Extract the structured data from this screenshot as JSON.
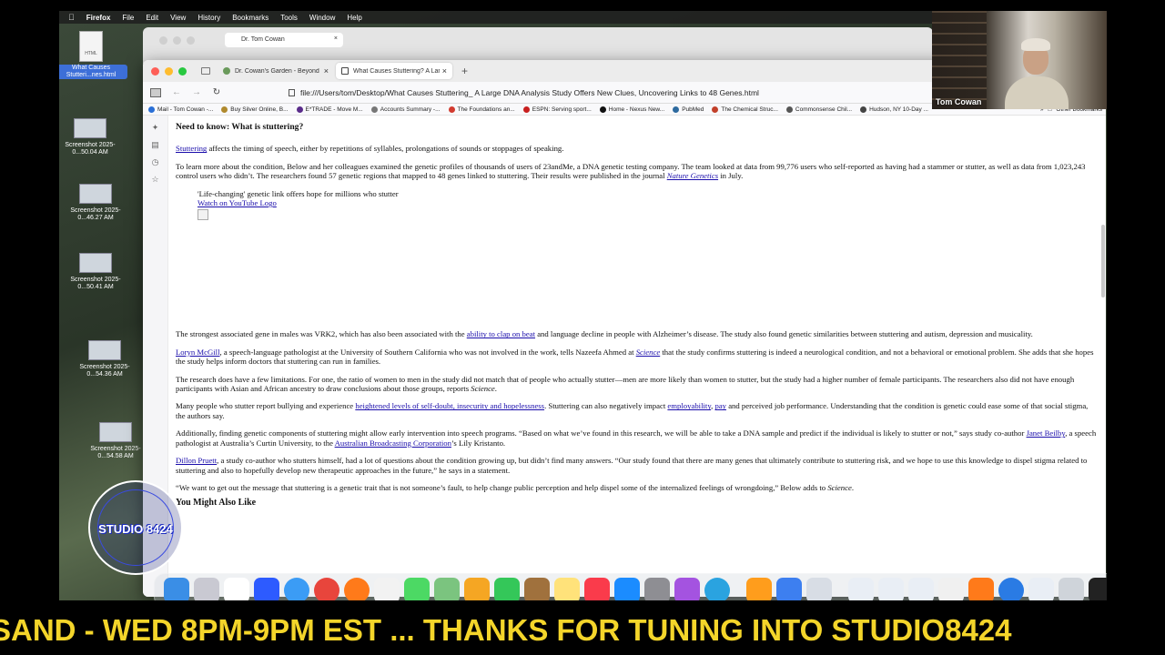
{
  "menubar": {
    "app_name": "Firefox",
    "items": [
      "File",
      "Edit",
      "View",
      "History",
      "Bookmarks",
      "Tools",
      "Window",
      "Help"
    ]
  },
  "desktop": {
    "icons": [
      {
        "label": "What Causes Stutteri...nes.html",
        "type": "file",
        "file_badge": "HTML",
        "selected": true
      },
      {
        "label": "Screenshot 2025-0...50.04 AM",
        "type": "screenshot"
      },
      {
        "label": "Screenshot 2025-0...46.27 AM",
        "type": "screenshot"
      },
      {
        "label": "Screenshot 2025-0...50.41 AM",
        "type": "screenshot"
      },
      {
        "label": "Screenshot 2025-0...54.36 AM",
        "type": "screenshot"
      },
      {
        "label": "Screenshot 2025-0...54.58 AM",
        "type": "screenshot"
      }
    ]
  },
  "background_window": {
    "tab_title": "Dr. Tom Cowan"
  },
  "browser": {
    "tabs": [
      {
        "title": "Dr. Cowan's Garden - Beyond C",
        "active": false
      },
      {
        "title": "What Causes Stuttering? A Larg",
        "active": true
      }
    ],
    "url": "file:///Users/tom/Desktop/What Causes Stuttering_ A Large DNA Analysis Study Offers New Clues, Uncovering Links to 48 Genes.html",
    "bookmarks": [
      "Mail - Tom Cowan -...",
      "Buy Silver Online, B...",
      "E*TRADE - Move M...",
      "Accounts Summary -...",
      "The Foundations an...",
      "ESPN: Serving sport...",
      "Home - Nexus New...",
      "PubMed",
      "The Chemical Struc...",
      "Commonsense Chil...",
      "Hudson, NY 10-Day ..."
    ],
    "other_bookmarks": "Other Bookmarks"
  },
  "article": {
    "heading": "Need to know: What is stuttering?",
    "p1": {
      "link": "Stuttering",
      "rest": " affects the timing of speech, either by repetitions of syllables, prolongations of sounds or stoppages of speaking."
    },
    "p2": {
      "text": "To learn more about the condition, Below and her colleagues examined the genetic profiles of thousands of users of 23andMe, a DNA genetic testing company. The team looked at data from 99,776 users who self-reported as having had a stammer or stutter, as well as data from 1,023,243 control users who didn’t. The researchers found 57 genetic regions that mapped to 48 genes linked to stuttering. Their results were published in the journal ",
      "link": "Nature Genetics",
      "end": " in July."
    },
    "embed": {
      "title": "'Life-changing' genetic link offers hope for millions who stutter",
      "link": "Watch on YouTube Logo"
    },
    "p3": {
      "text": "The strongest associated gene in males was VRK2, which has also been associated with the ",
      "link": "ability to clap on beat",
      "end": " and language decline in people with Alzheimer’s disease. The study also found genetic similarities between stuttering and autism, depression and musicality."
    },
    "p4": {
      "link": "Loryn McGill",
      "text": ", a speech-language pathologist at the University of Southern California who was not involved in the work, tells Nazeefa Ahmed at ",
      "link2": "Science",
      "end": " that the study confirms stuttering is indeed a neurological condition, and not a behavioral or emotional problem. She adds that she hopes the study helps inform doctors that stuttering can run in families."
    },
    "p5": {
      "text": "The research does have a few limitations. For one, the ratio of women to men in the study did not match that of people who actually stutter—men are more likely than women to stutter, but the study had a higher number of female participants. The researchers also did not have enough participants with Asian and African ancestry to draw conclusions about those groups, reports ",
      "ital": "Science",
      "end": "."
    },
    "p6": {
      "text": "Many people who stutter report bullying and experience ",
      "link": "heightened levels of self-doubt, insecurity and hopelessness",
      "mid": ". Stuttering can also negatively impact ",
      "link2": "employability",
      "comma": ", ",
      "link3": "pay",
      "end": " and perceived job performance. Understanding that the condition is genetic could ease some of that social stigma, the authors say."
    },
    "p7": {
      "text": "Additionally, finding genetic components of stuttering might allow early intervention into speech programs. “Based on what we’ve found in this research, we will be able to take a DNA sample and predict if the individual is likely to stutter or not,” says study co-author ",
      "link": "Janet Beilby",
      "mid": ", a speech pathologist at Australia’s Curtin University, to the ",
      "link2": "Australian Broadcasting Corporation",
      "end": "’s Lily Kristanto."
    },
    "p8": {
      "link": "Dillon Pruett",
      "text": ", a study co-author who stutters himself, had a lot of questions about the condition growing up, but didn’t find many answers. “Our study found that there are many genes that ultimately contribute to stuttering risk, and we hope to use this knowledge to dispel stigma related to stuttering and also to hopefully develop new therapeutic approaches in the future,” he says in a statement."
    },
    "p9": {
      "text": "“We want to get out the message that stuttering is a genetic trait that is not someone’s fault, to help change public perception and help dispel some of the internalized feelings of wrongdoing,” Below adds to ",
      "ital": "Science",
      "end": "."
    },
    "more_heading": "You Might Also Like"
  },
  "webcam": {
    "name": "Tom Cowan"
  },
  "studio_logo": {
    "text": "STUDIO 8424"
  },
  "ticker": {
    "text": "SAND - WED 8PM-9PM EST ...    THANKS FOR TUNING INTO STUDIO8424"
  },
  "colors": {
    "link": "#1a0dab",
    "ticker": "#f4d52a"
  }
}
